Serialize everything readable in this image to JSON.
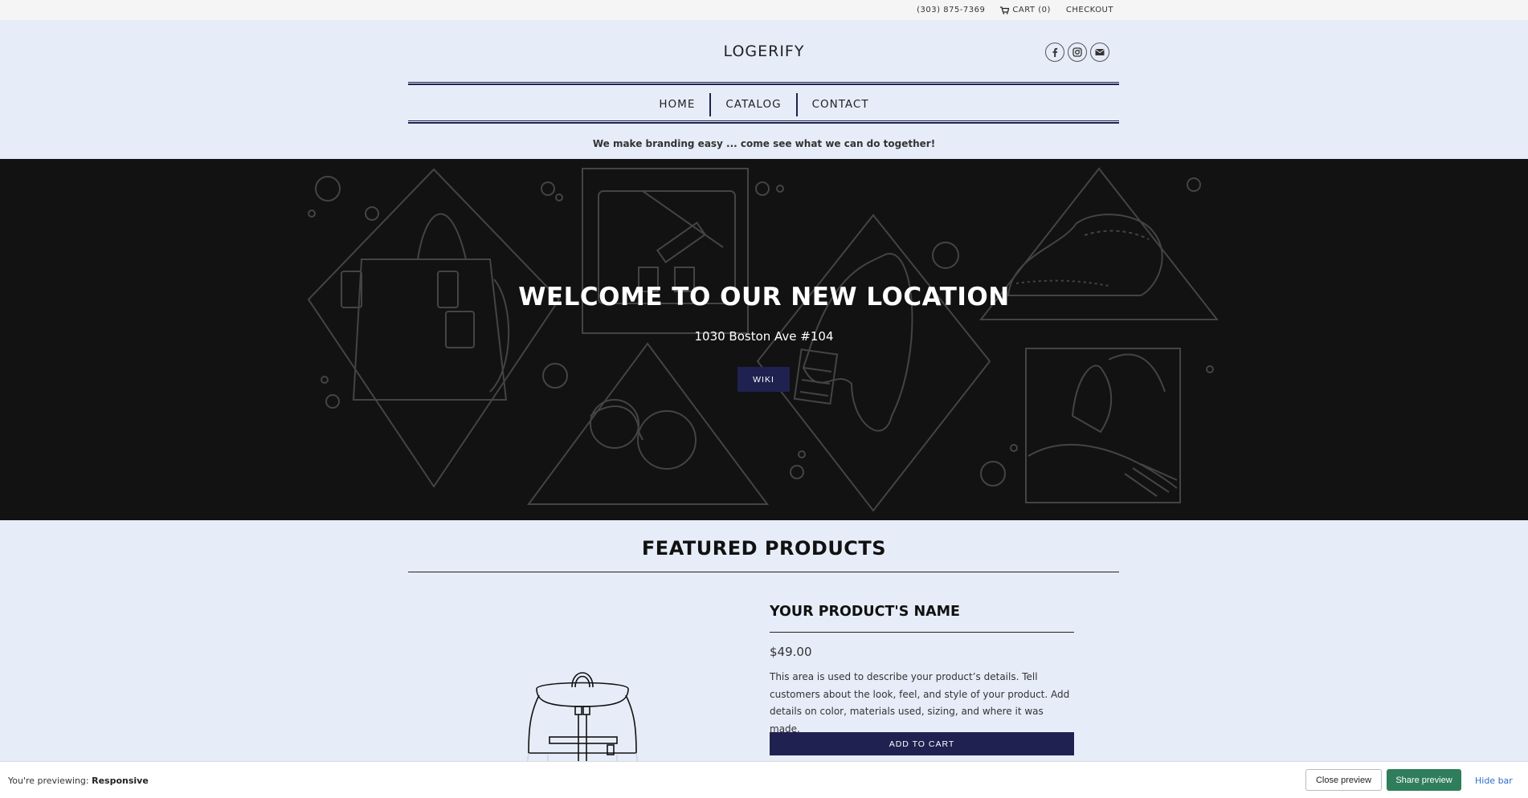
{
  "topbar": {
    "phone": "(303) 875-7369",
    "cart": "CART (0)",
    "checkout": "CHECKOUT"
  },
  "header": {
    "logo": "LOGERIFY",
    "social": [
      "facebook-icon",
      "instagram-icon",
      "email-icon"
    ]
  },
  "nav": {
    "items": [
      {
        "label": "HOME"
      },
      {
        "label": "CATALOG"
      },
      {
        "label": "CONTACT"
      }
    ]
  },
  "tagline": "We make branding easy ... come see what we can do together!",
  "hero": {
    "title": "WELCOME TO OUR NEW LOCATION",
    "subtitle": "1030 Boston Ave #104",
    "button": "WIKI"
  },
  "featured": {
    "title": "FEATURED PRODUCTS",
    "product": {
      "name": "YOUR PRODUCT'S NAME",
      "price": "$49.00",
      "description": "This area is used to describe your product’s details. Tell customers about the look, feel, and style of your product. Add details on color, materials used, sizing, and where it was made.",
      "add_to_cart": "ADD TO CART"
    }
  },
  "preview_bar": {
    "label_prefix": "You're previewing:",
    "label_value": "Responsive",
    "close": "Close preview",
    "share": "Share preview",
    "hide": "Hide bar"
  },
  "colors": {
    "background": "#e6edf9",
    "accent": "#1f2250",
    "hero_bg": "#121212",
    "share_green": "#2f7d5b",
    "link_blue": "#2c6ecb"
  }
}
